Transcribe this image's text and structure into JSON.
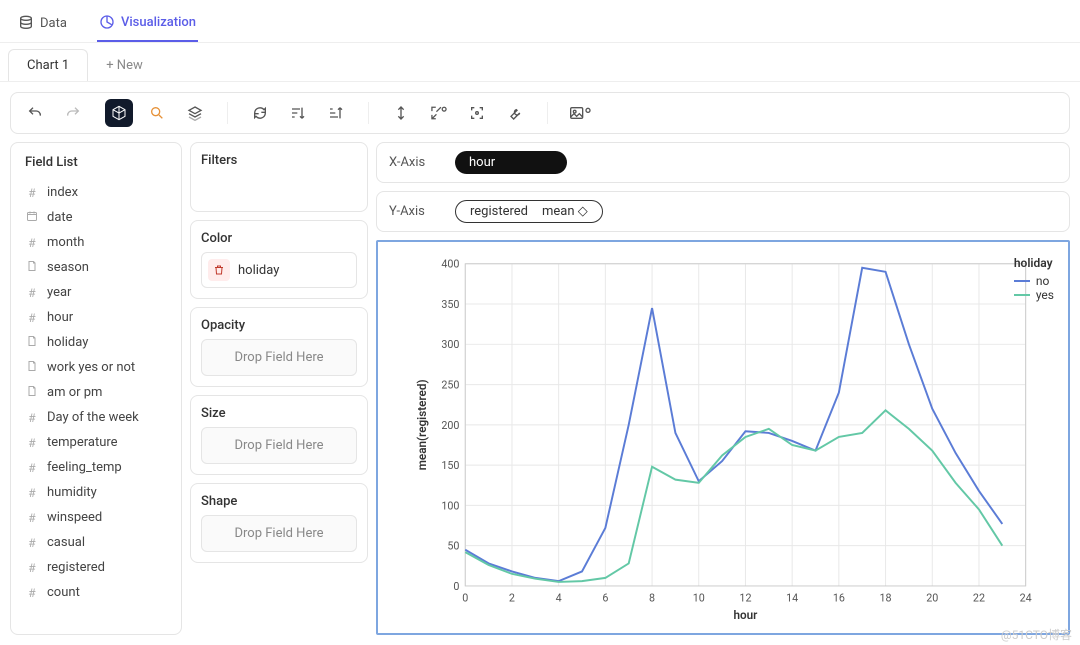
{
  "top_tabs": {
    "data": "Data",
    "viz": "Visualization"
  },
  "chart_tabs": {
    "current": "Chart 1",
    "new": "+ New"
  },
  "field_list": {
    "title": "Field List",
    "items": [
      {
        "icon": "#",
        "label": "index"
      },
      {
        "icon": "d",
        "label": "date"
      },
      {
        "icon": "#",
        "label": "month"
      },
      {
        "icon": "f",
        "label": "season"
      },
      {
        "icon": "#",
        "label": "year"
      },
      {
        "icon": "#",
        "label": "hour"
      },
      {
        "icon": "f",
        "label": "holiday"
      },
      {
        "icon": "f",
        "label": "work yes or not"
      },
      {
        "icon": "f",
        "label": "am or pm"
      },
      {
        "icon": "#",
        "label": "Day of the week"
      },
      {
        "icon": "#",
        "label": "temperature"
      },
      {
        "icon": "#",
        "label": "feeling_temp"
      },
      {
        "icon": "#",
        "label": "humidity"
      },
      {
        "icon": "#",
        "label": "winspeed"
      },
      {
        "icon": "#",
        "label": "casual"
      },
      {
        "icon": "#",
        "label": "registered"
      },
      {
        "icon": "#",
        "label": "count"
      }
    ]
  },
  "encodings": {
    "filters_label": "Filters",
    "color_label": "Color",
    "color_field": "holiday",
    "opacity_label": "Opacity",
    "size_label": "Size",
    "shape_label": "Shape",
    "drop_hint": "Drop Field Here"
  },
  "axes": {
    "x_label": "X-Axis",
    "x_field": "hour",
    "y_label": "Y-Axis",
    "y_field": "registered",
    "y_agg": "mean ◇"
  },
  "chart_data": {
    "type": "line",
    "title": "",
    "xlabel": "hour",
    "ylabel": "mean(registered)",
    "xlim": [
      0,
      24
    ],
    "ylim": [
      0,
      400
    ],
    "x": [
      0,
      1,
      2,
      3,
      4,
      5,
      6,
      7,
      8,
      9,
      10,
      11,
      12,
      13,
      14,
      15,
      16,
      17,
      18,
      19,
      20,
      21,
      22,
      23
    ],
    "series": [
      {
        "name": "no",
        "color": "#5b7cd6",
        "values": [
          45,
          28,
          18,
          10,
          6,
          18,
          72,
          200,
          345,
          190,
          130,
          155,
          192,
          190,
          180,
          168,
          240,
          395,
          390,
          300,
          220,
          165,
          118,
          77
        ]
      },
      {
        "name": "yes",
        "color": "#63c8a6",
        "values": [
          42,
          26,
          15,
          9,
          5,
          6,
          10,
          28,
          148,
          132,
          128,
          162,
          185,
          195,
          175,
          168,
          185,
          190,
          218,
          195,
          168,
          128,
          95,
          50
        ]
      }
    ],
    "legend_title": "holiday"
  },
  "watermark": "@51CTO博客"
}
